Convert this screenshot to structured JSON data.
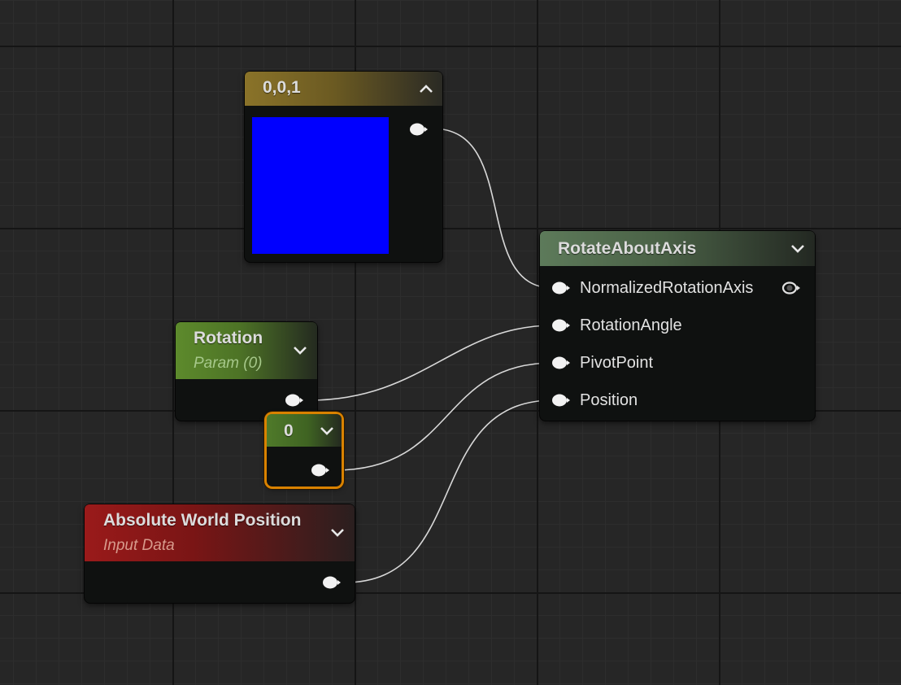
{
  "nodes": {
    "constant_vector": {
      "title": "0,0,1",
      "preview_color": "#0000ff",
      "header_color": "#8a7329"
    },
    "rotate_about_axis": {
      "title": "RotateAboutAxis",
      "header_color": "#5d7a5a",
      "inputs": [
        "NormalizedRotationAxis",
        "RotationAngle",
        "PivotPoint",
        "Position"
      ]
    },
    "rotation_param": {
      "title": "Rotation",
      "subtitle": "Param (0)",
      "header_color": "#5d8a2c"
    },
    "constant_zero": {
      "title": "0",
      "header_color": "#4f7a2a",
      "selection_color": "#d98200"
    },
    "absolute_world_position": {
      "title": "Absolute World Position",
      "subtitle": "Input Data",
      "header_color": "#9a1a1a"
    }
  },
  "icons": {
    "collapse": "chevron-up-icon",
    "expand": "chevron-down-icon",
    "pin": "exec-pin-icon",
    "output_pin_hollow": "hollow-pin-icon"
  }
}
